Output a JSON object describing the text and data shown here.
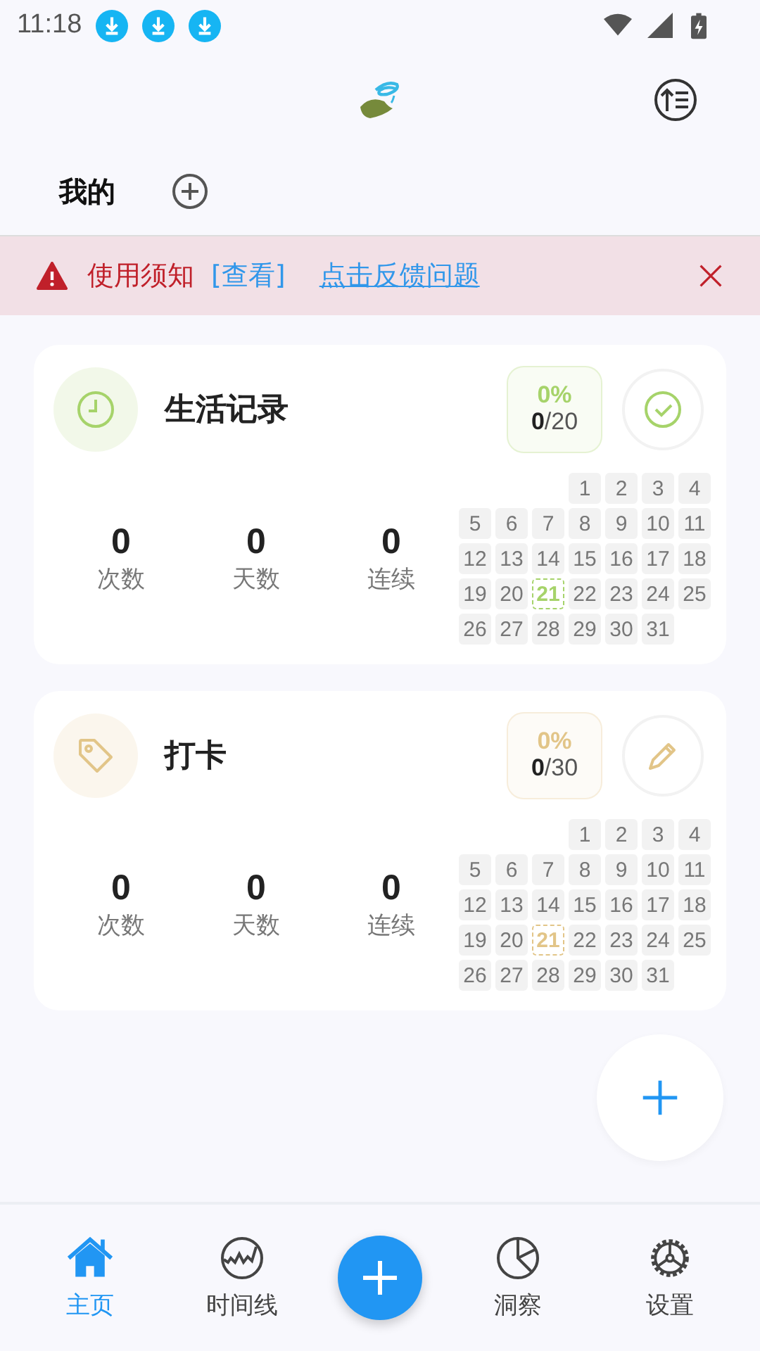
{
  "status_bar": {
    "time": "11:18"
  },
  "tabs": [
    {
      "label": "我的",
      "selected": true
    }
  ],
  "banner": {
    "notice": "使用须知",
    "view_link": "[查看]",
    "feedback_link": "点击反馈问题"
  },
  "cards": [
    {
      "title": "生活记录",
      "kind": "record",
      "color": "#a6d36a",
      "percent": "0%",
      "done": "0",
      "total": "/20",
      "stats": [
        {
          "value": "0",
          "label": "次数"
        },
        {
          "value": "0",
          "label": "天数"
        },
        {
          "value": "0",
          "label": "连续"
        }
      ],
      "weeks": [
        [
          {
            "label": "1",
            "selected": false
          },
          {
            "label": "2",
            "selected": false
          },
          {
            "label": "3",
            "selected": false
          },
          {
            "label": "4",
            "selected": false
          }
        ],
        [
          {
            "label": "5",
            "selected": false
          },
          {
            "label": "6",
            "selected": false
          },
          {
            "label": "7",
            "selected": false
          },
          {
            "label": "8",
            "selected": false
          },
          {
            "label": "9",
            "selected": false
          },
          {
            "label": "10",
            "selected": false
          },
          {
            "label": "11",
            "selected": false
          }
        ],
        [
          {
            "label": "12",
            "selected": false
          },
          {
            "label": "13",
            "selected": false
          },
          {
            "label": "14",
            "selected": false
          },
          {
            "label": "15",
            "selected": false
          },
          {
            "label": "16",
            "selected": false
          },
          {
            "label": "17",
            "selected": false
          },
          {
            "label": "18",
            "selected": false
          }
        ],
        [
          {
            "label": "19",
            "selected": false
          },
          {
            "label": "20",
            "selected": false
          },
          {
            "label": "21",
            "selected": true
          },
          {
            "label": "22",
            "selected": false
          },
          {
            "label": "23",
            "selected": false
          },
          {
            "label": "24",
            "selected": false
          },
          {
            "label": "25",
            "selected": false
          }
        ],
        [
          {
            "label": "26",
            "selected": false
          },
          {
            "label": "27",
            "selected": false
          },
          {
            "label": "28",
            "selected": false
          },
          {
            "label": "29",
            "selected": false
          },
          {
            "label": "30",
            "selected": false
          },
          {
            "label": "31",
            "selected": false
          }
        ]
      ]
    },
    {
      "title": "打卡",
      "kind": "checkin",
      "color": "#e2c588",
      "percent": "0%",
      "done": "0",
      "total": "/30",
      "stats": [
        {
          "value": "0",
          "label": "次数"
        },
        {
          "value": "0",
          "label": "天数"
        },
        {
          "value": "0",
          "label": "连续"
        }
      ],
      "weeks": [
        [
          {
            "label": "1",
            "selected": false
          },
          {
            "label": "2",
            "selected": false
          },
          {
            "label": "3",
            "selected": false
          },
          {
            "label": "4",
            "selected": false
          }
        ],
        [
          {
            "label": "5",
            "selected": false
          },
          {
            "label": "6",
            "selected": false
          },
          {
            "label": "7",
            "selected": false
          },
          {
            "label": "8",
            "selected": false
          },
          {
            "label": "9",
            "selected": false
          },
          {
            "label": "10",
            "selected": false
          },
          {
            "label": "11",
            "selected": false
          }
        ],
        [
          {
            "label": "12",
            "selected": false
          },
          {
            "label": "13",
            "selected": false
          },
          {
            "label": "14",
            "selected": false
          },
          {
            "label": "15",
            "selected": false
          },
          {
            "label": "16",
            "selected": false
          },
          {
            "label": "17",
            "selected": false
          },
          {
            "label": "18",
            "selected": false
          }
        ],
        [
          {
            "label": "19",
            "selected": false
          },
          {
            "label": "20",
            "selected": false
          },
          {
            "label": "21",
            "selected": true
          },
          {
            "label": "22",
            "selected": false
          },
          {
            "label": "23",
            "selected": false
          },
          {
            "label": "24",
            "selected": false
          },
          {
            "label": "25",
            "selected": false
          }
        ],
        [
          {
            "label": "26",
            "selected": false
          },
          {
            "label": "27",
            "selected": false
          },
          {
            "label": "28",
            "selected": false
          },
          {
            "label": "29",
            "selected": false
          },
          {
            "label": "30",
            "selected": false
          },
          {
            "label": "31",
            "selected": false
          }
        ]
      ]
    }
  ],
  "nav": [
    {
      "label": "主页",
      "selected": true
    },
    {
      "label": "时间线",
      "selected": false
    },
    {
      "label": "洞察",
      "selected": false
    },
    {
      "label": "设置",
      "selected": false
    }
  ]
}
